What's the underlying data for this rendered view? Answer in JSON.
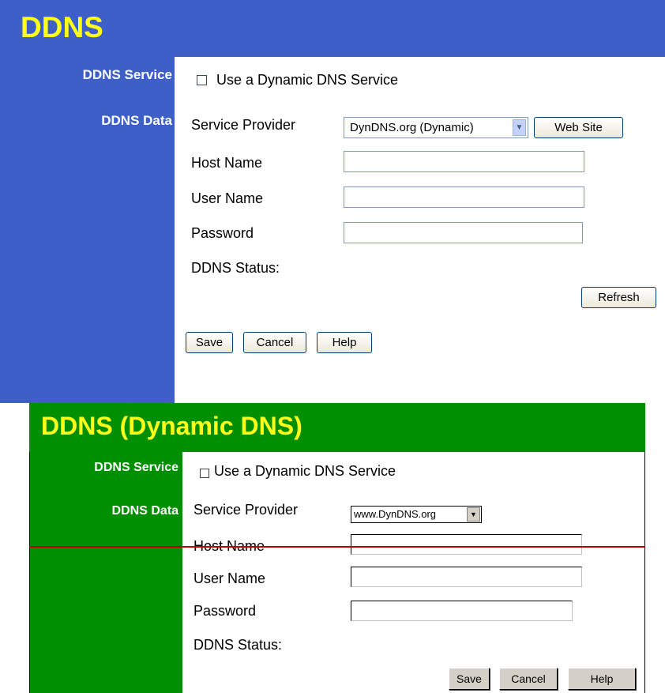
{
  "panel1": {
    "title": "DDNS",
    "sidebar": {
      "service_label": "DDNS Service",
      "data_label": "DDNS Data"
    },
    "checkbox_label": "Use a Dynamic DNS Service",
    "service_provider_label": "Service Provider",
    "service_provider_value": "DynDNS.org (Dynamic)",
    "web_site_button": "Web Site",
    "host_name_label": "Host Name",
    "user_name_label": "User Name",
    "password_label": "Password",
    "ddns_status_label": "DDNS Status:",
    "refresh_button": "Refresh",
    "save_button": "Save",
    "cancel_button": "Cancel",
    "help_button": "Help",
    "colors": {
      "header": "#3d5fc7",
      "title": "#ffff1a"
    }
  },
  "panel2": {
    "title": "DDNS (Dynamic DNS)",
    "sidebar": {
      "service_label": "DDNS Service",
      "data_label": "DDNS Data"
    },
    "checkbox_label": "Use a Dynamic DNS Service",
    "service_provider_label": "Service Provider",
    "service_provider_value": "www.DynDNS.org",
    "host_name_label": "Host Name",
    "user_name_label": "User Name",
    "password_label": "Password",
    "ddns_status_label": "DDNS Status:",
    "save_button": "Save",
    "cancel_button": "Cancel",
    "help_button": "Help",
    "colors": {
      "header": "#008f00",
      "title": "#ffff1a"
    }
  },
  "icons": {
    "select_arrow": "chevron-down-icon"
  }
}
